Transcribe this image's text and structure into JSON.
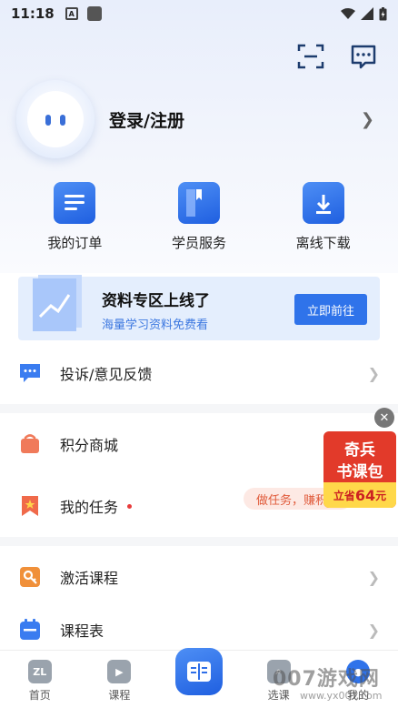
{
  "status_bar": {
    "time": "11:18",
    "a_icon": "A"
  },
  "profile": {
    "login_label": "登录/注册"
  },
  "quick_actions": [
    {
      "label": "我的订单",
      "icon": "order-list-icon"
    },
    {
      "label": "学员服务",
      "icon": "book-icon"
    },
    {
      "label": "离线下载",
      "icon": "download-folder-icon"
    }
  ],
  "banner": {
    "title": "资料专区上线了",
    "subtitle": "海量学习资料免费看",
    "button": "立即前往"
  },
  "menu": {
    "feedback": "投诉/意见反馈",
    "points_mall": "积分商城",
    "my_tasks": "我的任务",
    "task_pill": "做任务，赚积分",
    "activate_course": "激活课程",
    "schedule": "课程表"
  },
  "ad": {
    "line1": "奇兵",
    "line2": "书课包",
    "prefix": "立省",
    "amount": "64",
    "unit": "元"
  },
  "tabbar": {
    "home": "首页",
    "courses": "课程",
    "select": "选课",
    "mine": "我的",
    "home_glyph": "ZL"
  },
  "watermark": {
    "text": "007游戏网",
    "url": "www.yx007.com"
  },
  "colors": {
    "accent": "#2f73ea",
    "red": "#e23a2a"
  }
}
